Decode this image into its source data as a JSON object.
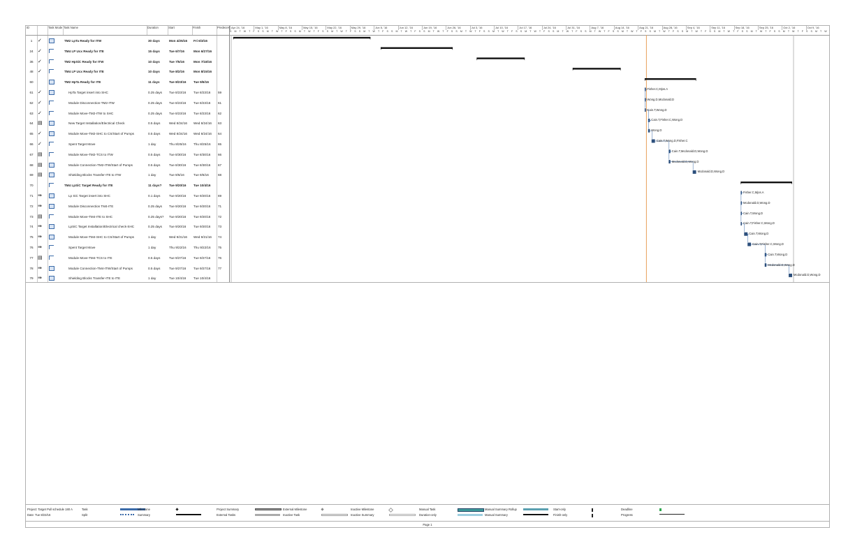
{
  "columns": {
    "id": "ID",
    "indicator": "",
    "mode": "Task Mode",
    "name": "Task Name",
    "duration": "Duration",
    "start": "Start",
    "finish": "Finish",
    "pred": "Predecessors"
  },
  "weeks": [
    "Apr 24, '16",
    "May 1, '16",
    "May 8, '16",
    "May 15, '16",
    "May 22, '16",
    "May 29, '16",
    "Jun 5, '16",
    "Jun 12, '16",
    "Jun 19, '16",
    "Jun 26, '16",
    "Jul 3, '16",
    "Jul 10, '16",
    "Jul 17, '16",
    "Jul 24, '16",
    "Jul 31, '16",
    "Aug 7, '16",
    "Aug 14, '16",
    "Aug 21, '16",
    "Aug 28, '16",
    "Sep 4, '16",
    "Sep 11, '16",
    "Sep 18, '16",
    "Sep 25, '16",
    "Oct 2, '16",
    "Oct 9, '16"
  ],
  "day_letters": "S M T W T F S",
  "tasks": [
    {
      "id": "1",
      "check": "✓",
      "mode": "auto",
      "name": "TM2 LpTa Ready for ITW",
      "duration": "30 days",
      "start": "Mon 4/25/16",
      "finish": "Fri 6/3/16",
      "pred": "",
      "summary": true,
      "indent": 0,
      "resources": ""
    },
    {
      "id": "24",
      "check": "✓",
      "mode": "manual",
      "name": "TM4 LP Ucx Ready for ITE",
      "duration": "15 days",
      "start": "Tue 6/7/16",
      "finish": "Mon 6/27/16",
      "pred": "",
      "summary": true,
      "indent": 0,
      "resources": ""
    },
    {
      "id": "36",
      "check": "✓",
      "mode": "manual",
      "name": "TM2 HpSiC Ready for ITW",
      "duration": "10 days",
      "start": "Tue 7/5/16",
      "finish": "Mon 7/18/16",
      "pred": "",
      "summary": true,
      "indent": 0,
      "resources": ""
    },
    {
      "id": "48",
      "check": "✓",
      "mode": "manual",
      "name": "TM4 LP Ucx Ready for ITE",
      "duration": "10 days",
      "start": "Tue 8/2/16",
      "finish": "Mon 8/15/16",
      "pred": "",
      "summary": true,
      "indent": 0,
      "resources": ""
    },
    {
      "id": "60",
      "check": "",
      "mode": "auto",
      "name": "TM2 HpTa Ready for ITE",
      "duration": "11 days",
      "start": "Tue 8/23/16",
      "finish": "Tue 9/6/16",
      "pred": "",
      "summary": true,
      "indent": 0,
      "resources": ""
    },
    {
      "id": "61",
      "check": "✓",
      "mode": "auto",
      "name": "HpTa Target insert into SHC",
      "duration": "0.25 days",
      "start": "Tue 8/23/16",
      "finish": "Tue 8/23/16",
      "pred": "59",
      "summary": false,
      "indent": 1,
      "resources": "Fisher.C,Mjos.A"
    },
    {
      "id": "62",
      "check": "✓",
      "mode": "manual",
      "name": "Module Disconnection-TM2-ITW",
      "duration": "0.25 days",
      "start": "Tue 8/23/16",
      "finish": "Tue 8/23/16",
      "pred": "61",
      "summary": false,
      "indent": 1,
      "resources": "Wong.D,Mcdonald.D"
    },
    {
      "id": "63",
      "check": "✓",
      "mode": "manual",
      "name": "Module Move-TM2-ITW to SHC",
      "duration": "0.25 days",
      "start": "Tue 8/23/16",
      "finish": "Tue 8/23/16",
      "pred": "62",
      "summary": false,
      "indent": 1,
      "resources": "Cain.T,Wong.D"
    },
    {
      "id": "64",
      "check": "▤",
      "mode": "auto",
      "name": "New Target Installation/Electrical Check",
      "duration": "0.5 days",
      "start": "Wed 8/24/16",
      "finish": "Wed 8/24/16",
      "pred": "63",
      "summary": false,
      "indent": 1,
      "resources": "Cain.T,Fisher.C,Wong.D"
    },
    {
      "id": "65",
      "check": "✓",
      "mode": "auto",
      "name": "Module Move-TM2-SHC to CS/Start of Pumps",
      "duration": "0.5 days",
      "start": "Wed 8/24/16",
      "finish": "Wed 8/24/16",
      "pred": "64",
      "summary": false,
      "indent": 1,
      "resources": "Wong.D"
    },
    {
      "id": "66",
      "check": "✓",
      "mode": "manual",
      "name": "Spent Target Move",
      "duration": "1 day",
      "start": "Thu 8/25/16",
      "finish": "Thu 8/25/16",
      "pred": "65",
      "summary": false,
      "indent": 1,
      "resources": "Cain.T,Wong.D,Fisher.C"
    },
    {
      "id": "67",
      "check": "▤",
      "mode": "manual",
      "name": "Module Move-TM2-TCS to ITW",
      "duration": "0.5 days",
      "start": "Tue 8/30/16",
      "finish": "Tue 8/30/16",
      "pred": "66",
      "summary": false,
      "indent": 1,
      "resources": "Cain.T,Mcdonald.D,Wong.D"
    },
    {
      "id": "68",
      "check": "▤",
      "mode": "auto",
      "name": "Module Connection-TM2-ITW/Start of Pumps",
      "duration": "0.5 days",
      "start": "Tue 8/30/16",
      "finish": "Tue 8/30/16",
      "pred": "67",
      "summary": false,
      "indent": 1,
      "resources": "Mcdonald.D,Wong.D"
    },
    {
      "id": "69",
      "check": "▤",
      "mode": "auto",
      "name": "Shielding Blocks Transfer-ITE to ITW",
      "duration": "1 day",
      "start": "Tue 9/6/16",
      "finish": "Tue 9/6/16",
      "pred": "68",
      "summary": false,
      "indent": 1,
      "resources": "Mcdonald.D,Wong.D"
    },
    {
      "id": "70",
      "check": "",
      "mode": "manual",
      "name": "TM4 LpSiC Target Ready for ITE",
      "duration": "11 days?",
      "start": "Tue 9/20/16",
      "finish": "Tue 10/4/16",
      "pred": "",
      "summary": true,
      "indent": 0,
      "resources": ""
    },
    {
      "id": "71",
      "check": "⇛",
      "mode": "auto",
      "name": "Lp SiC Target insert into SHC",
      "duration": "0.1 days",
      "start": "Tue 9/20/16",
      "finish": "Tue 9/20/16",
      "pred": "69",
      "summary": false,
      "indent": 1,
      "resources": "Fisher.C,Mjos.A"
    },
    {
      "id": "72",
      "check": "⇛",
      "mode": "auto",
      "name": "Module Disconnection TM4-ITE",
      "duration": "0.25 days",
      "start": "Tue 9/20/16",
      "finish": "Tue 9/20/16",
      "pred": "71",
      "summary": false,
      "indent": 1,
      "resources": "Mcdonald.D,Wong.D"
    },
    {
      "id": "73",
      "check": "▤",
      "mode": "manual",
      "name": "Module Move-TM4-ITE to SHC",
      "duration": "0.25 days?",
      "start": "Tue 9/20/16",
      "finish": "Tue 9/20/16",
      "pred": "72",
      "summary": false,
      "indent": 1,
      "resources": "Cain.T,Wong.D"
    },
    {
      "id": "74",
      "check": "⇛",
      "mode": "auto",
      "name": "LpSiC Target Installation/Electrical check-SHC",
      "duration": "0.25 days",
      "start": "Tue 9/20/16",
      "finish": "Tue 9/20/16",
      "pred": "73",
      "summary": false,
      "indent": 1,
      "resources": "Cain.T,Fisher.C,Wong.D"
    },
    {
      "id": "75",
      "check": "⇛",
      "mode": "auto",
      "name": "Module Move-TM4-SHC to CS/Start of Pumps",
      "duration": "1 day",
      "start": "Wed 9/21/16",
      "finish": "Wed 9/21/16",
      "pred": "74",
      "summary": false,
      "indent": 1,
      "resources": "Cain.T,Wong.D"
    },
    {
      "id": "76",
      "check": "⇛",
      "mode": "manual",
      "name": "Spent Target Move",
      "duration": "1 day",
      "start": "Thu 9/22/16",
      "finish": "Thu 9/22/16",
      "pred": "75",
      "summary": false,
      "indent": 1,
      "resources": "Cain.T,Fisher.C,Wong.D"
    },
    {
      "id": "77",
      "check": "▤",
      "mode": "manual",
      "name": "Module Move-TM4-TCS to ITE",
      "duration": "0.5 days",
      "start": "Tue 9/27/16",
      "finish": "Tue 9/27/16",
      "pred": "76",
      "summary": false,
      "indent": 1,
      "resources": "Cain.T,Wong.D"
    },
    {
      "id": "78",
      "check": "⇛",
      "mode": "auto",
      "name": "Module Connection-TM4-ITW/Start of Pumps",
      "duration": "0.5 days",
      "start": "Tue 9/27/16",
      "finish": "Tue 9/27/16",
      "pred": "77",
      "summary": false,
      "indent": 1,
      "resources": "Mcdonald.D,Wong.D"
    },
    {
      "id": "79",
      "check": "⇛",
      "mode": "auto",
      "name": "Shielding Blocks Transfer-ITE to ITE",
      "duration": "1 day",
      "start": "Tue 10/4/16",
      "finish": "Tue 10/4/16",
      "pred": "",
      "summary": false,
      "indent": 1,
      "resources": "Mcdonald.D,Wong.D"
    }
  ],
  "legend": {
    "project": "Project: Target Pull schedule 180 A",
    "date": "Date: Tue 8/23/16",
    "items": [
      "Task",
      "Split",
      "Milestone",
      "Summary",
      "Project Summary",
      "External Tasks",
      "External Milestone",
      "Inactive Task",
      "Inactive Milestone",
      "Inactive Summary",
      "Manual Task",
      "Duration-only",
      "Manual Summary Rollup",
      "Manual Summary",
      "Start-only",
      "Finish-only",
      "Deadline",
      "Progress"
    ]
  },
  "footer": {
    "page": "Page 1"
  },
  "colors": {
    "summary": "#111111",
    "task": "#2c4f7c",
    "status_line": "#e8a15a",
    "deadline": "#2fa84f"
  }
}
